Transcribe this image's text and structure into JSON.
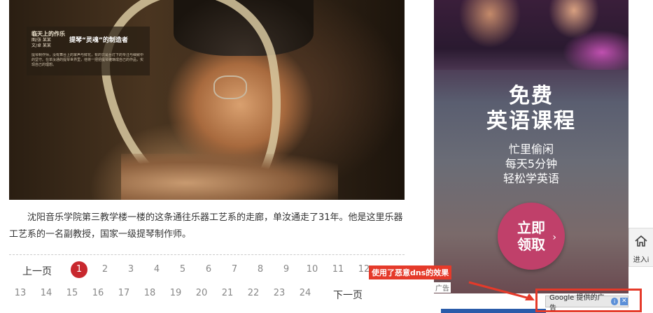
{
  "hero": {
    "caption": {
      "series": "临天上的作乐",
      "credit_photo": "图/张 某某",
      "credit_text": "文/卓 某某",
      "title": "提琴“灵魂”的制造者",
      "body": "提琴制作师，没有舞台上的掌声与鲜花，有的只是台灯下的专注与细致中的坚守。在单汝通的提琴世界里，他将一把把提琴雕琢成自己的作品，实现自己的理想。"
    }
  },
  "article": {
    "paragraph": "沈阳音乐学院第三教学楼一楼的这条通往乐器工艺系的走廊，单汝通走了31年。他是这里乐器工艺系的一名副教授，国家一级提琴制作师。"
  },
  "pagination": {
    "prev_label": "上一页",
    "next_label": "下一页",
    "current": "1",
    "pages": [
      "1",
      "2",
      "3",
      "4",
      "5",
      "6",
      "7",
      "8",
      "9",
      "10",
      "11",
      "12",
      "13",
      "14",
      "15",
      "16",
      "17",
      "18",
      "19",
      "20",
      "21",
      "22",
      "23",
      "24"
    ]
  },
  "ad": {
    "title_line1": "免费",
    "title_line2": "英语课程",
    "sub_line1": "忙里偷闲",
    "sub_line2": "每天5分钟",
    "sub_line3": "轻松学英语",
    "cta_line1": "立即",
    "cta_line2": "领取",
    "cta_arrow": "›",
    "label": "广告",
    "google_text": "Google 提供的广告",
    "info_glyph": "i",
    "close_glyph": "✕",
    "cta_color": "#c0406a"
  },
  "annotation": {
    "text": "使用了恶意dns的效果",
    "color": "#e53a2a"
  },
  "sidebar_tab": {
    "label": "进入i",
    "icon": "home-icon"
  }
}
